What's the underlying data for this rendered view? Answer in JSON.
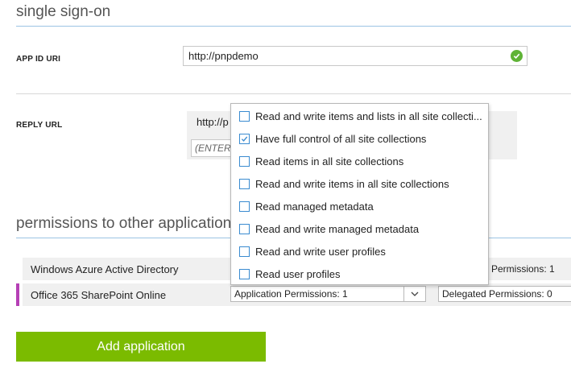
{
  "sso": {
    "title": "single sign-on"
  },
  "app_id": {
    "label": "APP ID URI",
    "value": "http://pnpdemo",
    "status_icon": "check-circle-icon"
  },
  "reply_url": {
    "label": "REPLY URL",
    "value": "http://p",
    "placeholder": "(ENTER"
  },
  "permissions": {
    "title": "permissions to other application",
    "apps": [
      {
        "name": "Windows Azure Active Directory",
        "delegated": "Permissions: 1"
      },
      {
        "name": "Office 365 SharePoint Online",
        "application": "Application Permissions: 1",
        "delegated": "Delegated Permissions: 0"
      }
    ],
    "dropdown_options": [
      {
        "label": "Read and write items and lists in all site collecti...",
        "checked": false
      },
      {
        "label": "Have full control of all site collections",
        "checked": true
      },
      {
        "label": "Read items in all site collections",
        "checked": false
      },
      {
        "label": "Read and write items in all site collections",
        "checked": false
      },
      {
        "label": "Read managed metadata",
        "checked": false
      },
      {
        "label": "Read and write managed metadata",
        "checked": false
      },
      {
        "label": "Read and write user profiles",
        "checked": false
      },
      {
        "label": "Read user profiles",
        "checked": false
      }
    ]
  },
  "add_button": {
    "label": "Add application"
  },
  "colors": {
    "accent_green": "#7bbb00",
    "check_blue": "#3a8bd0",
    "row_marker": "#b540b5",
    "valid_green": "#5fb336"
  }
}
